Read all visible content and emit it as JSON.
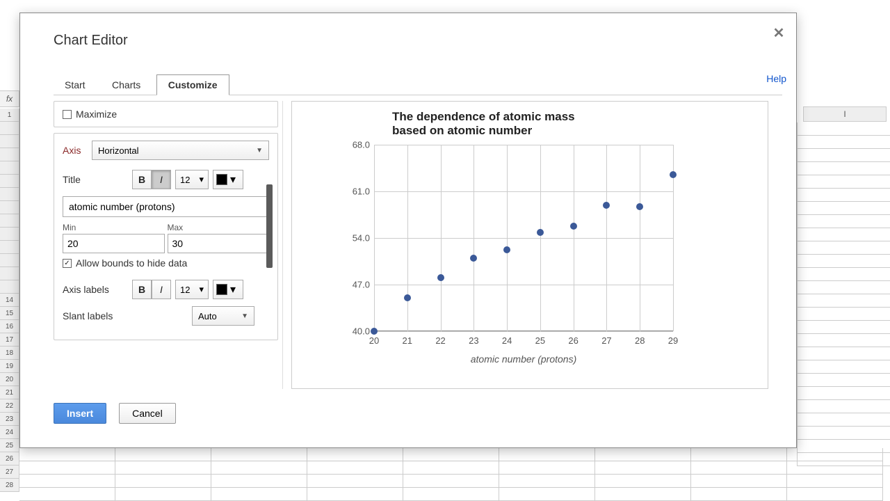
{
  "dialog": {
    "title": "Chart Editor",
    "tabs": [
      "Start",
      "Charts",
      "Customize"
    ],
    "active_tab": 2,
    "help": "Help",
    "insert": "Insert",
    "cancel": "Cancel"
  },
  "customize": {
    "maximize_label": "Maximize",
    "maximize_checked": false,
    "axis_label": "Axis",
    "axis_value": "Horizontal",
    "title_label": "Title",
    "title_fontsize": "12",
    "title_bold": false,
    "title_italic": true,
    "title_value": "atomic number (protons)",
    "min_label": "Min",
    "max_label": "Max",
    "min_value": "20",
    "max_value": "30",
    "allow_bounds_label": "Allow bounds to hide data",
    "allow_bounds_checked": true,
    "axis_labels_label": "Axis labels",
    "axis_labels_fontsize": "12",
    "slant_label": "Slant labels",
    "slant_value": "Auto"
  },
  "bg": {
    "fx": "fx",
    "col_i": "I",
    "rows": [
      "1",
      "",
      "",
      "",
      "",
      "",
      "",
      "",
      "",
      "",
      "",
      "",
      "",
      "",
      "14",
      "15",
      "16",
      "17",
      "18",
      "19",
      "20",
      "21",
      "22",
      "23",
      "24",
      "25",
      "26",
      "27",
      "28"
    ]
  },
  "chart_data": {
    "type": "scatter",
    "title": "The dependence of atomic mass based on atomic number",
    "xlabel": "atomic number (protons)",
    "ylabel": "",
    "xlim": [
      20,
      29
    ],
    "ylim": [
      40.0,
      68.0
    ],
    "yticks": [
      40.0,
      47.0,
      54.0,
      61.0,
      68.0
    ],
    "xticks": [
      20,
      21,
      22,
      23,
      24,
      25,
      26,
      27,
      28,
      29
    ],
    "x": [
      20,
      21,
      22,
      23,
      24,
      25,
      26,
      27,
      28,
      29
    ],
    "y": [
      40.0,
      45.0,
      48.0,
      51.0,
      52.2,
      54.8,
      55.8,
      58.9,
      58.7,
      63.5
    ]
  }
}
